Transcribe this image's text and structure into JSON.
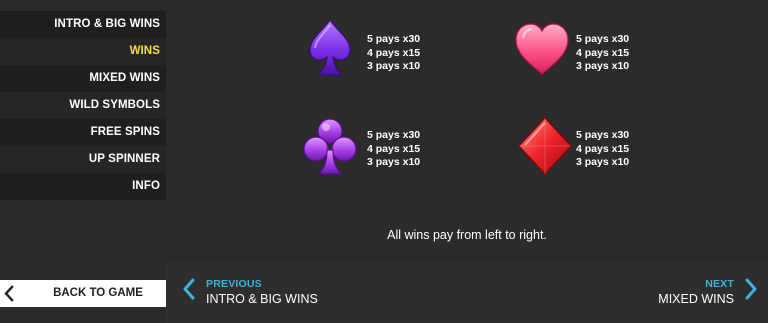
{
  "sidebar": {
    "items": [
      {
        "label": "INTRO & BIG WINS",
        "active": false
      },
      {
        "label": "WINS",
        "active": true
      },
      {
        "label": "MIXED WINS",
        "active": false
      },
      {
        "label": "WILD SYMBOLS",
        "active": false
      },
      {
        "label": "FREE SPINS",
        "active": false
      },
      {
        "label": "UP SPINNER",
        "active": false
      },
      {
        "label": "INFO",
        "active": false
      }
    ],
    "back_label": "BACK TO GAME",
    "active_color": "#f5e03a"
  },
  "symbols": [
    {
      "name": "spade",
      "color": "#8a3cf0",
      "pays": [
        "5 pays x30",
        "4 pays x15",
        "3 pays x10"
      ]
    },
    {
      "name": "heart",
      "color": "#ff5a8c",
      "pays": [
        "5 pays x30",
        "4 pays x15",
        "3 pays x10"
      ]
    },
    {
      "name": "club",
      "color": "#b048e8",
      "pays": [
        "5 pays x30",
        "4 pays x15",
        "3 pays x10"
      ]
    },
    {
      "name": "diamond",
      "color": "#f0222a",
      "pays": [
        "5 pays x30",
        "4 pays x15",
        "3 pays x10"
      ]
    }
  ],
  "note": "All wins pay from left to right.",
  "nav": {
    "prev_small": "PREVIOUS",
    "prev_big": "INTRO & BIG WINS",
    "next_small": "NEXT",
    "next_big": "MIXED WINS",
    "accent": "#3fb3d9"
  }
}
